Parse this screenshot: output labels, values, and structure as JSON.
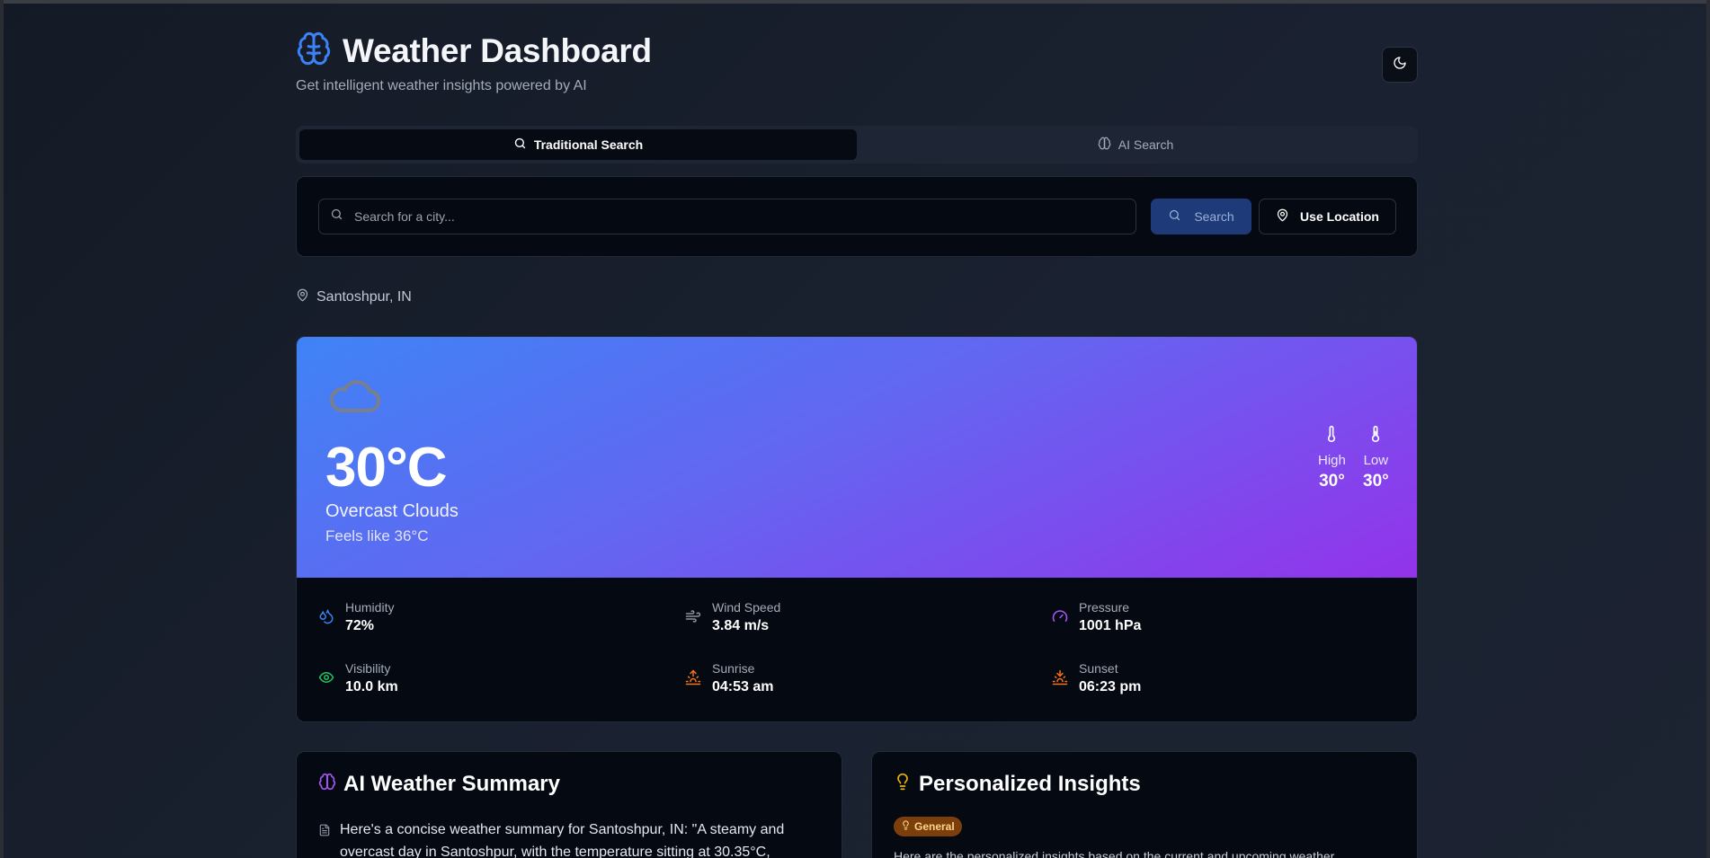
{
  "header": {
    "title": "Weather Dashboard",
    "subtitle": "Get intelligent weather insights powered by AI",
    "brand_icon": "brain-icon",
    "theme_icon": "moon-icon"
  },
  "tabs": [
    {
      "label": "Traditional Search",
      "icon": "search-icon",
      "active": true
    },
    {
      "label": "AI Search",
      "icon": "brain-icon",
      "active": false
    }
  ],
  "search": {
    "placeholder": "Search for a city...",
    "value": "",
    "search_label": "Search",
    "location_label": "Use Location"
  },
  "location": "Santoshpur, IN",
  "current": {
    "temperature": "30°C",
    "condition": "Overcast Clouds",
    "feels_like": "Feels like 36°C",
    "high_label": "High",
    "high_value": "30°",
    "low_label": "Low",
    "low_value": "30°"
  },
  "stats": [
    {
      "label": "Humidity",
      "value": "72%",
      "icon": "droplets-icon",
      "color": "#3b82f6"
    },
    {
      "label": "Wind Speed",
      "value": "3.84 m/s",
      "icon": "wind-icon",
      "color": "#8b93a1"
    },
    {
      "label": "Pressure",
      "value": "1001 hPa",
      "icon": "gauge-icon",
      "color": "#a855f7"
    },
    {
      "label": "Visibility",
      "value": "10.0 km",
      "icon": "eye-icon",
      "color": "#22c55e"
    },
    {
      "label": "Sunrise",
      "value": "04:53 am",
      "icon": "sunrise-icon",
      "color": "#f97316"
    },
    {
      "label": "Sunset",
      "value": "06:23 pm",
      "icon": "sunset-icon",
      "color": "#f97316"
    }
  ],
  "ai_summary": {
    "title": "AI Weather Summary",
    "text": "Here's a concise weather summary for Santoshpur, IN: \"A steamy and overcast day in Santoshpur, with the temperature sitting at 30.35°C,"
  },
  "insights": {
    "title": "Personalized Insights",
    "badge": "General",
    "text": "Here are the personalized insights based on the current and upcoming weather"
  },
  "colors": {
    "accent": "#3b82f6",
    "hero_start": "#3f83f6",
    "hero_end": "#9333ea",
    "badge_bg": "#7c3f0c"
  }
}
